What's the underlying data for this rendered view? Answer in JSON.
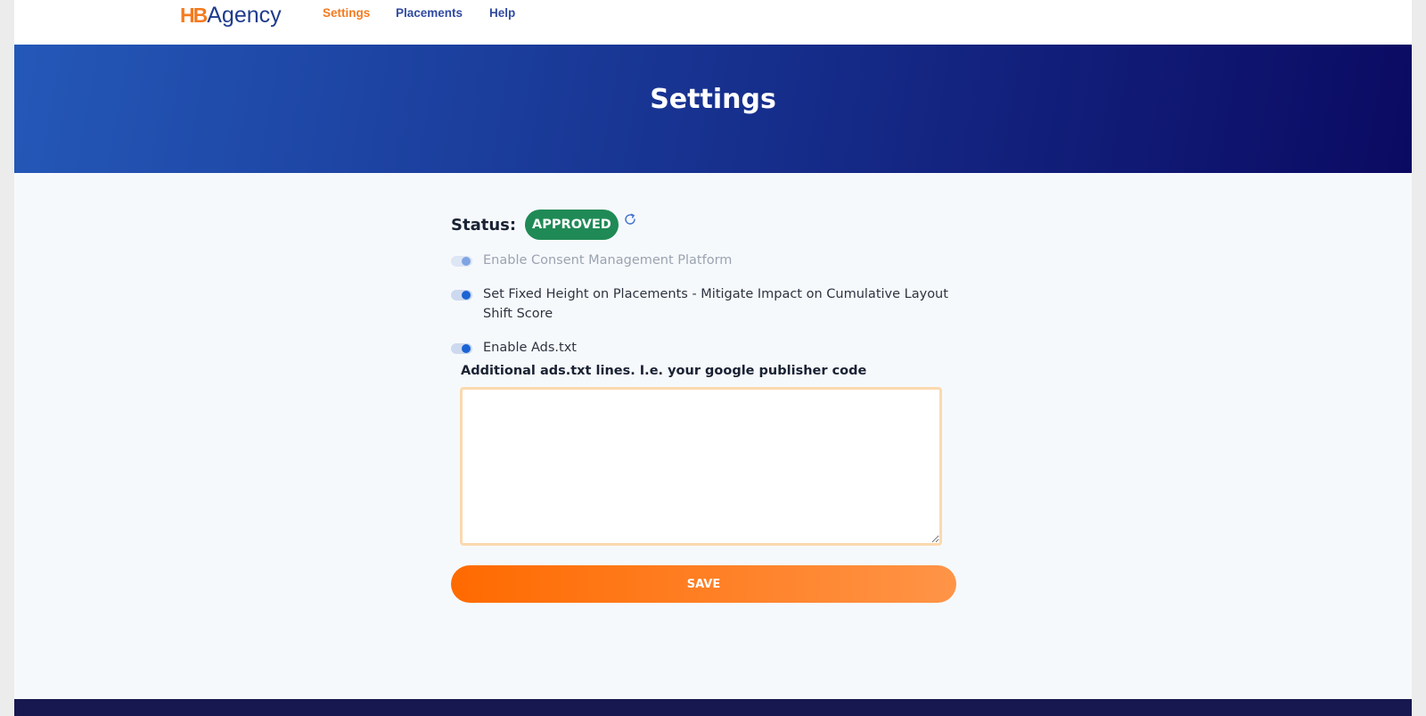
{
  "brand": {
    "logo_mark": "HB",
    "logo_text": "Agency"
  },
  "nav": [
    {
      "label": "Settings",
      "active": true
    },
    {
      "label": "Placements",
      "active": false
    },
    {
      "label": "Help",
      "active": false
    }
  ],
  "banner": {
    "title": "Settings"
  },
  "status": {
    "label": "Status:",
    "value": "APPROVED",
    "color": "#1f8a55"
  },
  "toggles": [
    {
      "label": "Enable Consent Management Platform",
      "enabled": true,
      "disabled": true
    },
    {
      "label": "Set Fixed Height on Placements - Mitigate Impact on Cumulative Layout Shift Score",
      "enabled": true,
      "disabled": false
    },
    {
      "label": "Enable Ads.txt",
      "enabled": true,
      "disabled": false
    }
  ],
  "ads_txt": {
    "label": "Additional ads.txt lines. I.e. your google publisher code",
    "value": ""
  },
  "save": {
    "label": "SAVE"
  },
  "colors": {
    "accent": "#f47b20",
    "primary": "#1f3c8c",
    "banner_dark": "#0b0a62"
  }
}
